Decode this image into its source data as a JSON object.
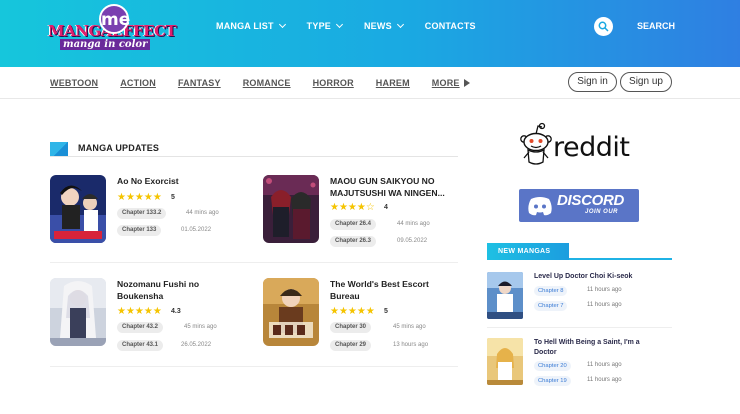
{
  "header": {
    "logo": {
      "badge": "me",
      "main": "MANGAEFFECT",
      "sub": "manga in color"
    },
    "nav": [
      {
        "label": "MANGA LIST",
        "dropdown": true
      },
      {
        "label": "TYPE",
        "dropdown": true
      },
      {
        "label": "NEWS",
        "dropdown": true
      },
      {
        "label": "CONTACTS",
        "dropdown": false
      }
    ],
    "search_label": "SEARCH",
    "search_icon": "search-icon"
  },
  "genres": [
    "WEBTOON",
    "ACTION",
    "FANTASY",
    "ROMANCE",
    "HORROR",
    "HAREM",
    "MORE"
  ],
  "auth": {
    "sign_in": "Sign in",
    "sign_up": "Sign up"
  },
  "updates": {
    "title": "MANGA UPDATES",
    "items": [
      {
        "title": "Ao No Exorcist",
        "stars": "★★★★★",
        "rating": "5",
        "chapters": [
          {
            "label": "Chapter 133.2",
            "time": "44 mins ago"
          },
          {
            "label": "Chapter 133",
            "time": "01.05.2022"
          }
        ]
      },
      {
        "title": "MAOU GUN SAIKYOU NO MAJUTSUSHI WA NINGEN...",
        "stars": "★★★★☆",
        "rating": "4",
        "chapters": [
          {
            "label": "Chapter 26.4",
            "time": "44 mins ago"
          },
          {
            "label": "Chapter 26.3",
            "time": "09.05.2022"
          }
        ]
      },
      {
        "title": "Nozomanu Fushi no Boukensha",
        "stars": "★★★★★",
        "rating": "4.3",
        "chapters": [
          {
            "label": "Chapter 43.2",
            "time": "45 mins ago"
          },
          {
            "label": "Chapter 43.1",
            "time": "26.05.2022"
          }
        ]
      },
      {
        "title": "The World's Best Escort Bureau",
        "stars": "★★★★★",
        "rating": "5",
        "chapters": [
          {
            "label": "Chapter 30",
            "time": "45 mins ago"
          },
          {
            "label": "Chapter 29",
            "time": "13 hours ago"
          }
        ]
      }
    ]
  },
  "sidebar": {
    "reddit": "reddit",
    "discord": {
      "word": "DISCORD",
      "sub": "JOIN OUR"
    },
    "new_mangas": {
      "title": "NEW MANGAS",
      "items": [
        {
          "title": "Level Up Doctor Choi Ki-seok",
          "chapters": [
            {
              "label": "Chapter 8",
              "time": "11 hours ago"
            },
            {
              "label": "Chapter 7",
              "time": "11 hours ago"
            }
          ]
        },
        {
          "title": "To Hell With Being a Saint, I'm a Doctor",
          "chapters": [
            {
              "label": "Chapter 20",
              "time": "11 hours ago"
            },
            {
              "label": "Chapter 19",
              "time": "11 hours ago"
            }
          ]
        }
      ]
    }
  },
  "colors": {
    "header_start": "#16c6dc",
    "header_end": "#2f7fe2",
    "accent": "#1fb2e5",
    "star": "#f5c400",
    "discord": "#5a75c7"
  }
}
